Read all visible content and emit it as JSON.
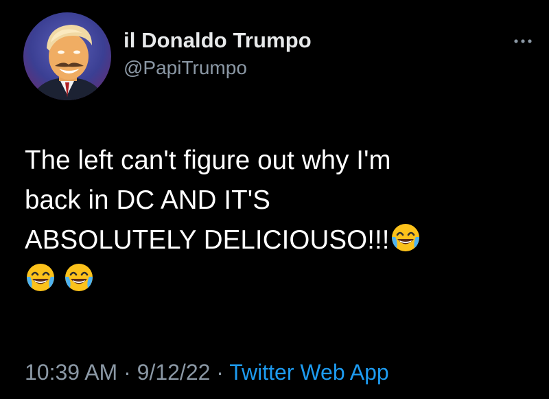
{
  "tweet": {
    "author": {
      "display_name": "il Donaldo Trumpo",
      "handle": "@PapiTrumpo"
    },
    "text_line1": "The left can't figure out why I'm",
    "text_line2": "back in DC AND IT'S",
    "text_line3": "ABSOLUTELY DELICIOUSO!!!",
    "emojis": [
      "face-with-tears-of-joy-icon",
      "face-with-tears-of-joy-icon",
      "face-with-tears-of-joy-icon"
    ],
    "time": "10:39 AM",
    "separator": "·",
    "date": "9/12/22",
    "source": "Twitter Web App"
  },
  "colors": {
    "background": "#000000",
    "text": "#ffffff",
    "secondary": "#8b98a5",
    "link": "#1d9bf0"
  },
  "icons": {
    "more": "more-options-icon",
    "avatar": "profile-avatar"
  }
}
